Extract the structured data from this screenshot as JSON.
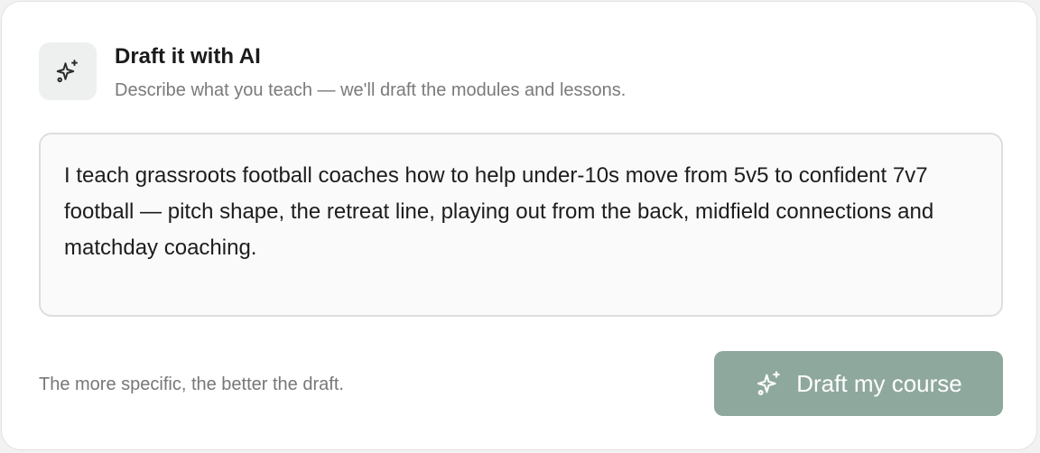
{
  "header": {
    "icon": "sparkles-icon",
    "title": "Draft it with AI",
    "subtitle": "Describe what you teach — we'll draft the modules and lessons."
  },
  "prompt": {
    "value": "I teach grassroots football coaches how to help under-10s move from 5v5 to confident 7v7 football — pitch shape, the retreat line, playing out from the back, midfield connections and matchday coaching."
  },
  "footer": {
    "hint": "The more specific, the better the draft.",
    "button_label": "Draft my course",
    "button_icon": "sparkles-icon"
  },
  "colors": {
    "button_bg": "#8fa89e",
    "icon_tile_bg": "#eef0ef",
    "card_bg": "#ffffff"
  }
}
